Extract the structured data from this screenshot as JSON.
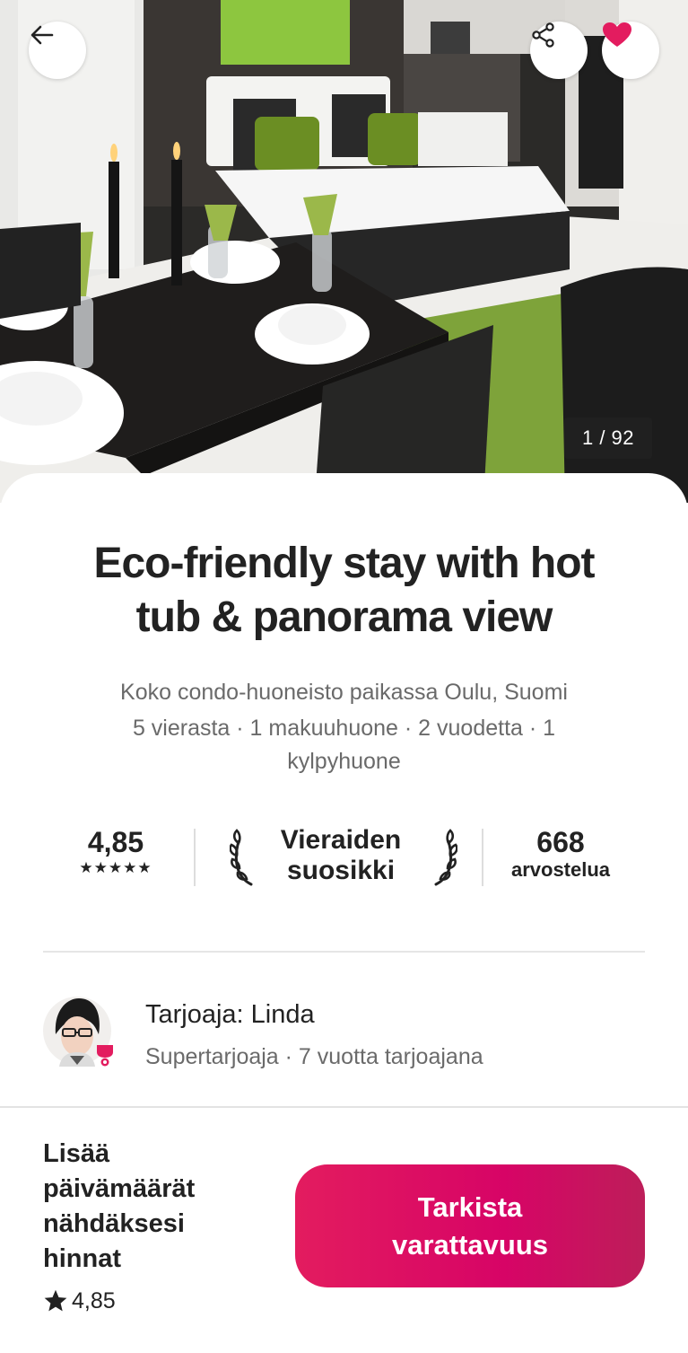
{
  "hero": {
    "photo_counter": "1 / 92",
    "back_label": "Back",
    "share_label": "Share",
    "favorite_label": "Saved"
  },
  "listing": {
    "title_line1": "Eco-friendly stay with hot",
    "title_line2": "tub & panorama view",
    "location": "Koko condo-huoneisto paikassa Oulu, Suomi",
    "details_line1": "5 vierasta · 1 makuuhuone · 2 vuodetta · 1",
    "details_line2": "kylpyhuone"
  },
  "stats": {
    "rating": "4,85",
    "stars": "★★★★★",
    "favorite_line1": "Vieraiden",
    "favorite_line2": "suosikki",
    "reviews_count": "668",
    "reviews_label": "arvostelua"
  },
  "host": {
    "title": "Tarjoaja: Linda",
    "subtitle": "Supertarjoaja · 7 vuotta tarjoajana"
  },
  "booking": {
    "price_line1": "Lisää",
    "price_line2": "päivämäärät",
    "price_line3": "nähdäksesi",
    "price_line4": "hinnat",
    "rating": "4,85",
    "cta_line1": "Tarkista",
    "cta_line2": "varattavuus"
  },
  "colors": {
    "accent": "#e31c5f",
    "heart": "#e31c5f",
    "text": "#222222",
    "muted": "#6a6a6a"
  }
}
